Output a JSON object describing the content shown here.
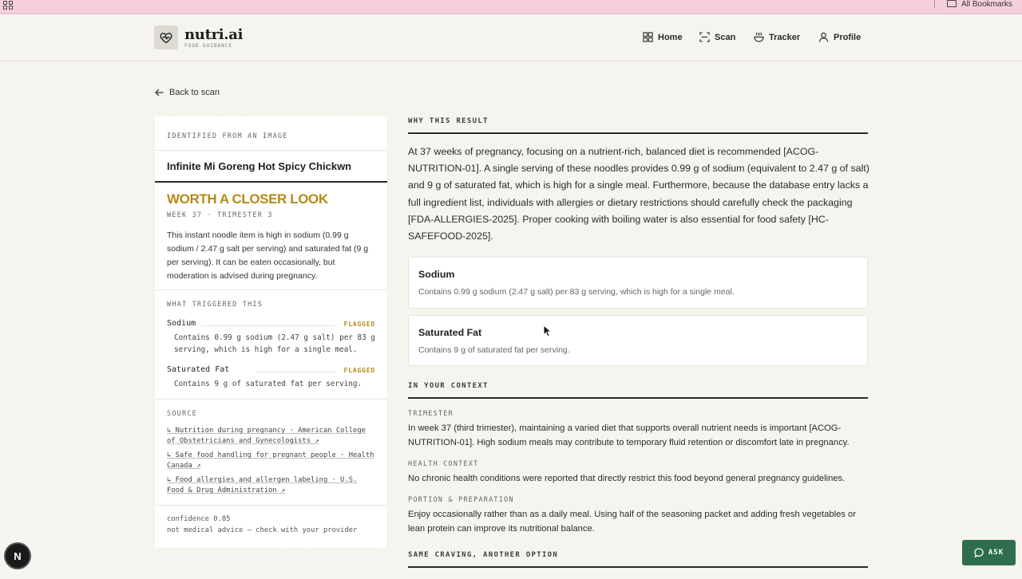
{
  "browser": {
    "bookmarks_label": "All Bookmarks"
  },
  "header": {
    "brand": "nutri.ai",
    "tagline": "FOOD GUIDANCE",
    "nav": [
      {
        "label": "Home",
        "icon": "grid-icon"
      },
      {
        "label": "Scan",
        "icon": "scan-icon"
      },
      {
        "label": "Tracker",
        "icon": "bowl-icon"
      },
      {
        "label": "Profile",
        "icon": "user-icon"
      }
    ]
  },
  "back_link": "Back to scan",
  "result_card": {
    "identified_label": "IDENTIFIED FROM AN IMAGE",
    "food_name": "Infinite Mi Goreng Hot Spicy Chickwn",
    "verdict": "WORTH A CLOSER LOOK",
    "week_line": "WEEK 37 · TRIMESTER 3",
    "summary": "This instant noodle item is high in sodium (0.99 g sodium / 2.47 g salt per serving) and saturated fat (9 g per serving). It can be eaten occasionally, but moderation is advised during pregnancy.",
    "triggers_label": "WHAT TRIGGERED THIS",
    "triggers": [
      {
        "name": "Sodium",
        "status": "FLAGGED",
        "desc": "Contains 0.99 g sodium (2.47 g salt) per 83 g serving, which is high for a single meal."
      },
      {
        "name": "Saturated Fat",
        "status": "FLAGGED",
        "desc": "Contains 9 g of saturated fat per serving."
      }
    ],
    "source_label": "SOURCE",
    "sources": [
      "↳ Nutrition during pregnancy · American College of Obstetricians and Gynecologists ↗",
      "↳ Safe food handling for pregnant people · Health Canada ↗",
      "↳ Food allergies and allergen labeling · U.S. Food & Drug Administration ↗"
    ],
    "confidence": "confidence 0.85",
    "disclaimer": "not medical advice — check with your provider"
  },
  "why": {
    "heading": "WHY THIS RESULT",
    "explanation": "At 37 weeks of pregnancy, focusing on a nutrient-rich, balanced diet is recommended [ACOG-NUTRITION-01]. A single serving of these noodles provides 0.99 g of sodium (equivalent to 2.47 g of salt) and 9 g of saturated fat, which is high for a single meal. Furthermore, because the database entry lacks a full ingredient list, individuals with allergies or dietary restrictions should carefully check the packaging [FDA-ALLERGIES-2025]. Proper cooking with boiling water is also essential for food safety [HC-SAFEFOOD-2025].",
    "boxes": [
      {
        "title": "Sodium",
        "desc": "Contains 0.99 g sodium (2.47 g salt) per 83 g serving, which is high for a single meal."
      },
      {
        "title": "Saturated Fat",
        "desc": "Contains 9 g of saturated fat per serving."
      }
    ]
  },
  "context": {
    "heading": "IN YOUR CONTEXT",
    "trimester_label": "TRIMESTER",
    "trimester_text": "In week 37 (third trimester), maintaining a varied diet that supports overall nutrient needs is important [ACOG-NUTRITION-01]. High sodium meals may contribute to temporary fluid retention or discomfort late in pregnancy.",
    "health_label": "HEALTH CONTEXT",
    "health_text": "No chronic health conditions were reported that directly restrict this food beyond general pregnancy guidelines.",
    "portion_label": "PORTION & PREPARATION",
    "portion_text": "Enjoy occasionally rather than as a daily meal. Using half of the seasoning packet and adding fresh vegetables or lean protein can improve its nutritional balance."
  },
  "alternative": {
    "heading": "SAME CRAVING, ANOTHER OPTION"
  },
  "dev_badge": "N",
  "ask_button": "ASK",
  "colors": {
    "accent_gold": "#b48a17",
    "ask_green": "#2e6e4f",
    "background": "#f6f4ee"
  }
}
